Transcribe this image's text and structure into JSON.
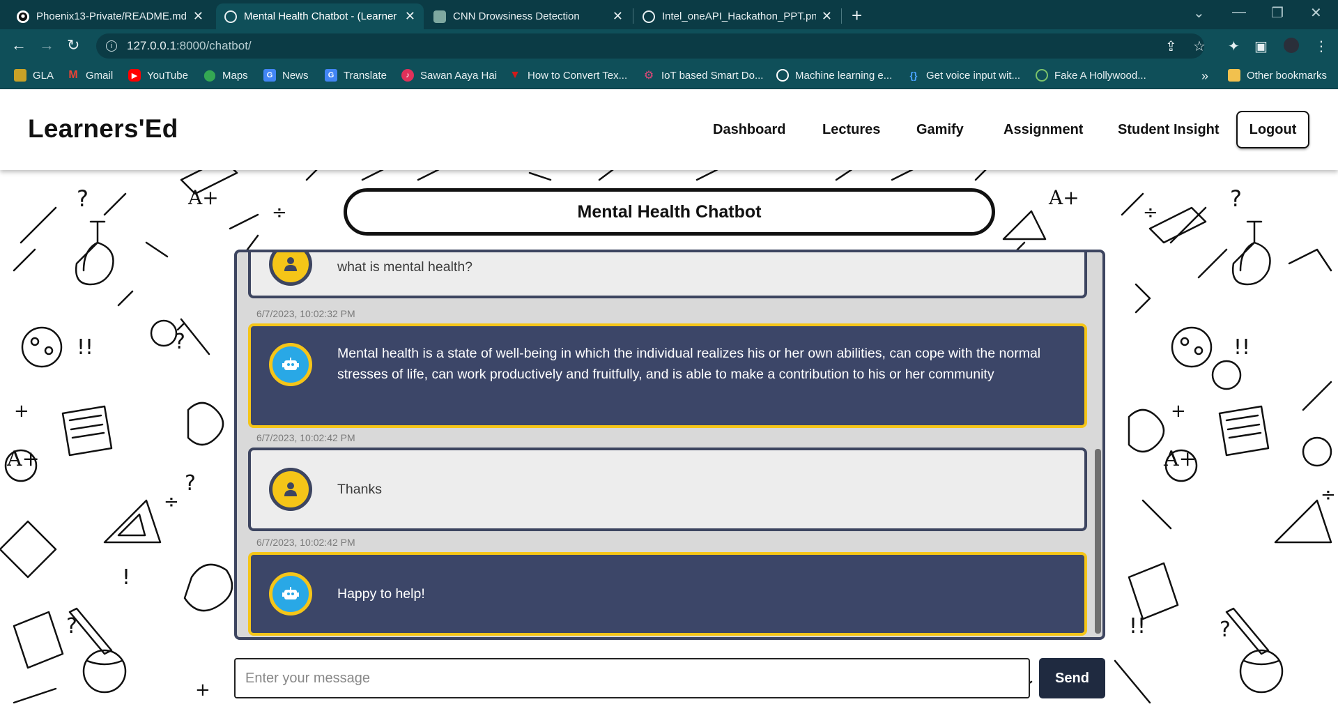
{
  "browser": {
    "tabs": [
      {
        "title": "Phoenix13-Private/README.md a",
        "favicon": "github-icon",
        "active": false
      },
      {
        "title": "Mental Health Chatbot - (Learner",
        "favicon": "globe-icon",
        "active": true
      },
      {
        "title": "CNN Drowsiness Detection",
        "favicon": "chatgpt-icon",
        "active": false
      },
      {
        "title": "Intel_oneAPI_Hackathon_PPT.png",
        "favicon": "globe-icon",
        "active": false
      }
    ],
    "url_host": "127.0.0.1",
    "url_path": ":8000/chatbot/",
    "bookmarks": [
      {
        "label": "GLA",
        "icon": "gla-icon",
        "color": "#c9a227"
      },
      {
        "label": "Gmail",
        "icon": "gmail-icon",
        "color": "#ea4335"
      },
      {
        "label": "YouTube",
        "icon": "youtube-icon",
        "color": "#ff0000"
      },
      {
        "label": "Maps",
        "icon": "maps-icon",
        "color": "#34a853"
      },
      {
        "label": "News",
        "icon": "news-icon",
        "color": "#4285f4"
      },
      {
        "label": "Translate",
        "icon": "translate-icon",
        "color": "#4285f4"
      },
      {
        "label": "Sawan Aaya Hai",
        "icon": "music-icon",
        "color": "#e0315a"
      },
      {
        "label": "How to Convert Tex...",
        "icon": "triangle-icon",
        "color": "#d11a1a"
      },
      {
        "label": "IoT based Smart Do...",
        "icon": "gear-icon",
        "color": "#e04878"
      },
      {
        "label": "Machine learning e...",
        "icon": "globe-icon",
        "color": "#ffffff"
      },
      {
        "label": "Get voice input wit...",
        "icon": "braces-icon",
        "color": "#4aa3ff"
      },
      {
        "label": "Fake A Hollywood...",
        "icon": "globe-icon",
        "color": "#7cc36b"
      }
    ],
    "other_bookmarks": "Other bookmarks"
  },
  "site": {
    "logo": "Learners'Ed",
    "nav": [
      "Dashboard",
      "Lectures",
      "Gamify",
      "Assignment",
      "Student Insight"
    ],
    "logout": "Logout"
  },
  "chat": {
    "title": "Mental Health Chatbot",
    "messages": [
      {
        "role": "user",
        "text": "what is mental health?",
        "timestamp": ""
      },
      {
        "role": "bot",
        "text": "Mental health is a state of well-being in which the individual realizes his or her own abilities, can cope with the normal stresses of life, can work productively and fruitfully, and is able to make a contribution to his or her community",
        "timestamp": "6/7/2023, 10:02:32 PM"
      },
      {
        "role": "user",
        "text": "Thanks",
        "timestamp": "6/7/2023, 10:02:42 PM"
      },
      {
        "role": "bot",
        "text": "Happy to help!",
        "timestamp": "6/7/2023, 10:02:42 PM"
      }
    ],
    "input_placeholder": "Enter your message",
    "send_label": "Send"
  },
  "colors": {
    "bot_bubble": "#3c4668",
    "bot_border": "#f5c518",
    "user_bubble": "#ededed",
    "user_border": "#3d4560",
    "send_button": "#1f2a40"
  }
}
